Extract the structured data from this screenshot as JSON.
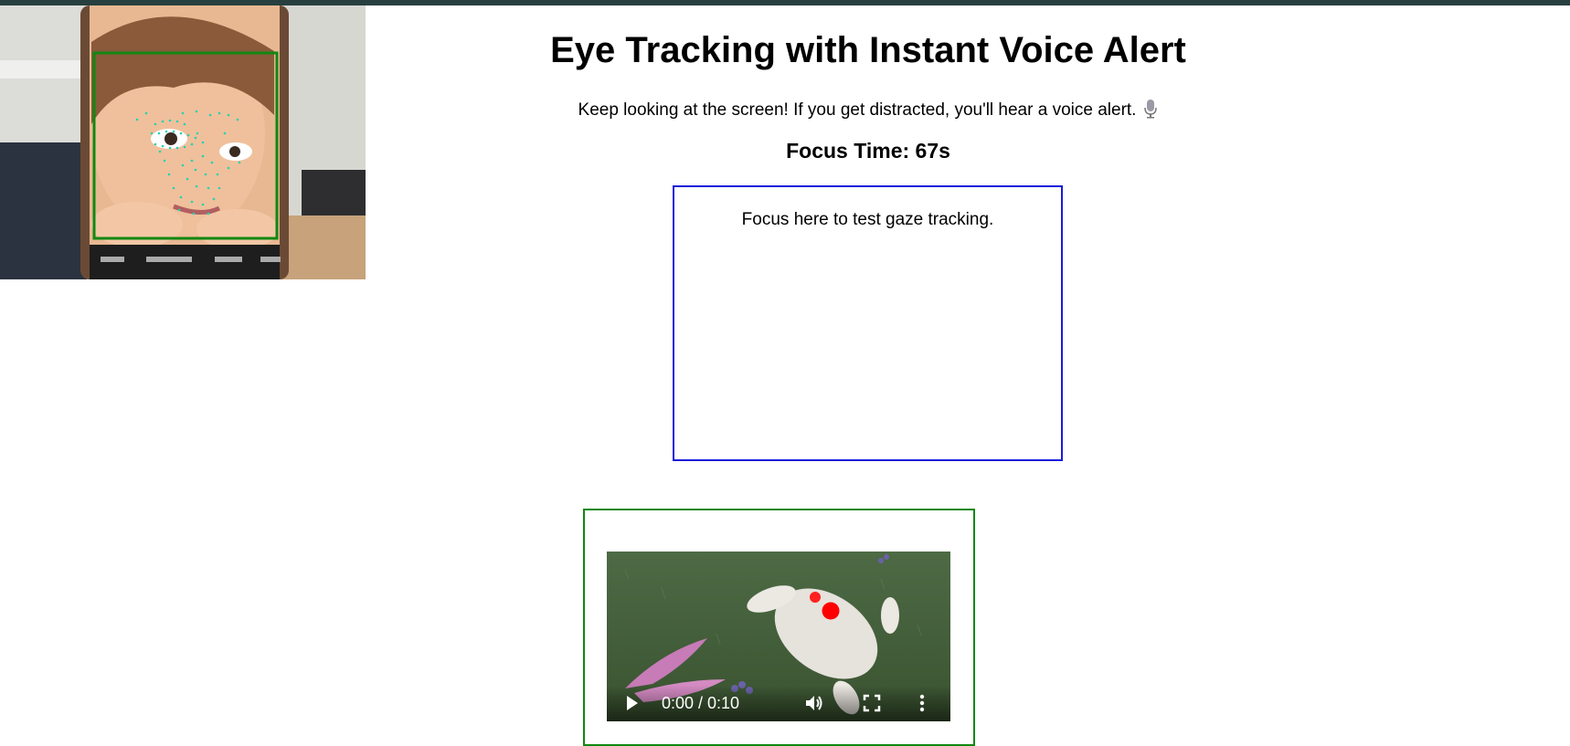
{
  "page": {
    "title": "Eye Tracking with Instant Voice Alert",
    "subtitle": "Keep looking at the screen! If you get distracted, you'll hear a voice alert.",
    "focus_time": "Focus Time: 67s"
  },
  "focus_area": {
    "text": "Focus here to test gaze tracking."
  },
  "video": {
    "time": "0:00 / 0:10",
    "progress": 0
  },
  "icons": {
    "subtitle_icon": "microphone-icon",
    "play": "play-icon",
    "volume": "volume-icon",
    "fullscreen": "fullscreen-icon",
    "more": "more-vert-icon"
  },
  "colors": {
    "top_bar": "#27403f",
    "focus_box_border": "#1a1adb",
    "video_frame_border": "#118811",
    "face_box": "#118811",
    "face_mesh": "#22d3b0",
    "gaze_dot": "#ff0000"
  }
}
